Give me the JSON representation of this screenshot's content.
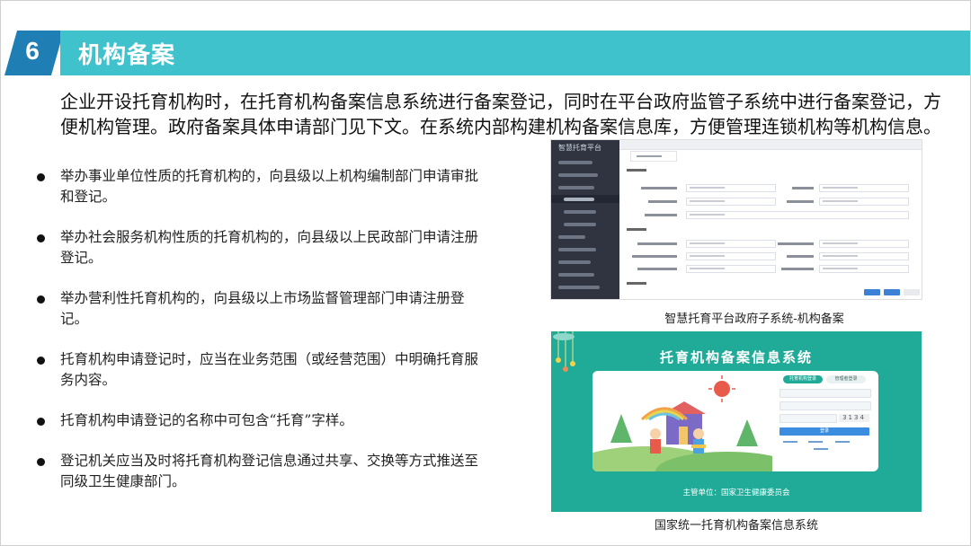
{
  "header": {
    "number": "6",
    "title": "机构备案",
    "accent_color": "#3fc2cc",
    "number_bg_color": "#1f7fb5"
  },
  "intro": "企业开设托育机构时，在托育机构备案信息系统进行备案登记，同时在平台政府监管子系统中进行备案登记，方便机构管理。政府备案具体申请部门见下文。在系统内部构建机构备案信息库，方便管理连锁机构等机构信息。",
  "bullets": [
    "举办事业单位性质的托育机构的，向县级以上机构编制部门申请审批和登记。",
    "举办社会服务机构性质的托育机构的，向县级以上民政部门申请注册登记。",
    "举办营利性托育机构的，向县级以上市场监督管理部门申请注册登记。",
    "托育机构申请登记时，应当在业务范围（或经营范围）中明确托育服务内容。",
    "托育机构申请登记的名称中可包含“托育”字样。",
    "登记机关应当及时将托育机构登记信息通过共享、交换等方式推送至同级卫生健康部门。"
  ],
  "screenshot1": {
    "app_name": "智慧托育平台",
    "caption": "智慧托育平台政府子系统-机构备案"
  },
  "screenshot2": {
    "title": "托育机构备案信息系统",
    "login_tab_1": "托育机构登录",
    "login_tab_2": "管理者登录",
    "login_button": "登录",
    "captcha": "3134",
    "footer": "主管单位：国家卫生健康委员会",
    "caption": "国家统一托育机构备案信息系统"
  }
}
